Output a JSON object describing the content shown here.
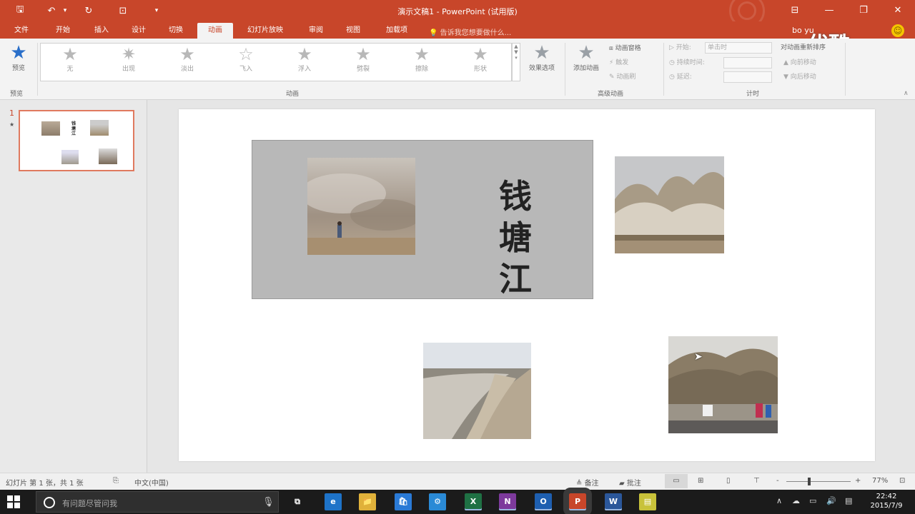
{
  "titlebar": {
    "title": "演示文稿1 - PowerPoint (试用版)",
    "quick_access": [
      {
        "name": "save-icon",
        "glyph": "🖫"
      },
      {
        "name": "undo-icon",
        "glyph": "↶"
      },
      {
        "name": "undo-dropdown-icon",
        "glyph": "▾"
      },
      {
        "name": "redo-icon",
        "glyph": "↻"
      },
      {
        "name": "present-from-start-icon",
        "glyph": "⊡"
      },
      {
        "name": "customize-qat-icon",
        "glyph": "▾"
      }
    ],
    "window_controls": [
      {
        "name": "ribbon-display-options-icon",
        "glyph": "⊟"
      },
      {
        "name": "minimize-icon",
        "glyph": "—"
      },
      {
        "name": "maximize-icon",
        "glyph": "❐"
      },
      {
        "name": "close-icon",
        "glyph": "✕"
      }
    ],
    "accent_color": "#c8462a"
  },
  "tabs": [
    {
      "label": "文件",
      "active": false
    },
    {
      "label": "开始",
      "active": false
    },
    {
      "label": "插入",
      "active": false
    },
    {
      "label": "设计",
      "active": false
    },
    {
      "label": "切换",
      "active": false
    },
    {
      "label": "动画",
      "active": true
    },
    {
      "label": "幻灯片放映",
      "active": false
    },
    {
      "label": "审阅",
      "active": false
    },
    {
      "label": "视图",
      "active": false
    },
    {
      "label": "加载项",
      "active": false
    }
  ],
  "tell_me": "告诉我您想要做什么...",
  "user": "bo yu",
  "watermark": "优酷",
  "ribbon": {
    "preview": {
      "label": "预览",
      "group": "预览"
    },
    "animation_gallery": [
      {
        "label": "无"
      },
      {
        "label": "出现"
      },
      {
        "label": "淡出"
      },
      {
        "label": "飞入"
      },
      {
        "label": "浮入"
      },
      {
        "label": "劈裂"
      },
      {
        "label": "擦除"
      },
      {
        "label": "形状"
      }
    ],
    "effect_options": "效果选项",
    "group_animation": "动画",
    "add_animation": "添加动画",
    "animation_pane": "动画窗格",
    "trigger": "触发",
    "animation_painter": "动画刷",
    "group_advanced": "高级动画",
    "start_label": "开始:",
    "start_value": "单击时",
    "duration_label": "持续时间:",
    "delay_label": "延迟:",
    "group_timing": "计时",
    "reorder_label": "对动画重新排序",
    "move_earlier": "向前移动",
    "move_later": "向后移动"
  },
  "thumbnails": {
    "slide_number": "1",
    "star": "★",
    "title_text": "钱塘江"
  },
  "slide": {
    "vertical_text": "钱\n塘\n江"
  },
  "statusbar": {
    "slide_info": "幻灯片 第 1 张，共 1 张",
    "language": "中文(中国)",
    "notes": "备注",
    "comments": "批注",
    "zoom_minus": "-",
    "zoom_plus": "+",
    "zoom": "77%"
  },
  "taskbar": {
    "search_placeholder": "有问题尽管问我",
    "apps": [
      {
        "name": "task-view-icon",
        "glyph": "⧉",
        "color": "#1b1b1b"
      },
      {
        "name": "edge-icon",
        "glyph": "e",
        "color": "#1e73c8"
      },
      {
        "name": "file-explorer-icon",
        "glyph": "📁",
        "color": "#e0b13a"
      },
      {
        "name": "store-icon",
        "glyph": "🛍",
        "color": "#2a7ad6"
      },
      {
        "name": "app-icon",
        "glyph": "⚙",
        "color": "#2a8ad6"
      },
      {
        "name": "excel-icon",
        "glyph": "X",
        "color": "#1f7144"
      },
      {
        "name": "onenote-icon",
        "glyph": "N",
        "color": "#7d3a9c"
      },
      {
        "name": "outlook-icon",
        "glyph": "O",
        "color": "#1e5fb0"
      },
      {
        "name": "powerpoint-icon",
        "glyph": "P",
        "color": "#c8462a"
      },
      {
        "name": "word-icon",
        "glyph": "W",
        "color": "#2b579a"
      },
      {
        "name": "sticky-notes-icon",
        "glyph": "▤",
        "color": "#c8c23a"
      }
    ],
    "time": "22:42",
    "date": "2015/7/9"
  }
}
